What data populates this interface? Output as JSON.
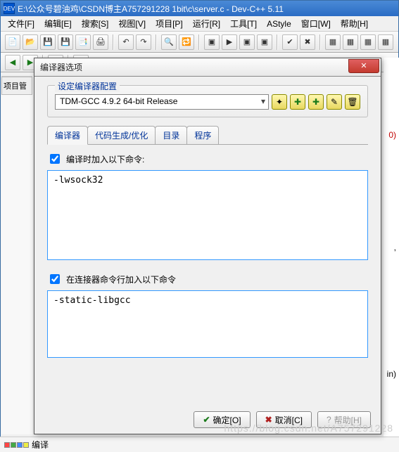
{
  "window": {
    "title": "E:\\公众号碧油鸡\\CSDN博主A757291228 1bit\\c\\server.c - Dev-C++ 5.11",
    "icon_label": "DEV"
  },
  "menu": [
    "文件[F]",
    "编辑[E]",
    "搜索[S]",
    "视图[V]",
    "项目[P]",
    "运行[R]",
    "工具[T]",
    "AStyle",
    "窗口[W]",
    "帮助[H]"
  ],
  "left_tab": "项目管",
  "dialog": {
    "title": "编译器选项",
    "close": "✕",
    "group_legend": "设定编译器配置",
    "compiler_selected": "TDM-GCC 4.9.2 64-bit Release",
    "tabs": [
      "编译器",
      "代码生成/优化",
      "目录",
      "程序"
    ],
    "check1_label": "编译时加入以下命令:",
    "textarea1_value": "-lwsock32",
    "check2_label": "在连接器命令行加入以下命令",
    "textarea2_value": "-static-libgcc",
    "ok": "确定[O]",
    "cancel": "取消[C]",
    "help": "帮助[H]"
  },
  "code_fragments": [
    "0)",
    ",",
    "in)"
  ],
  "status_tab": "编译",
  "watermark": "https://blog.csdn.net/A757291228"
}
